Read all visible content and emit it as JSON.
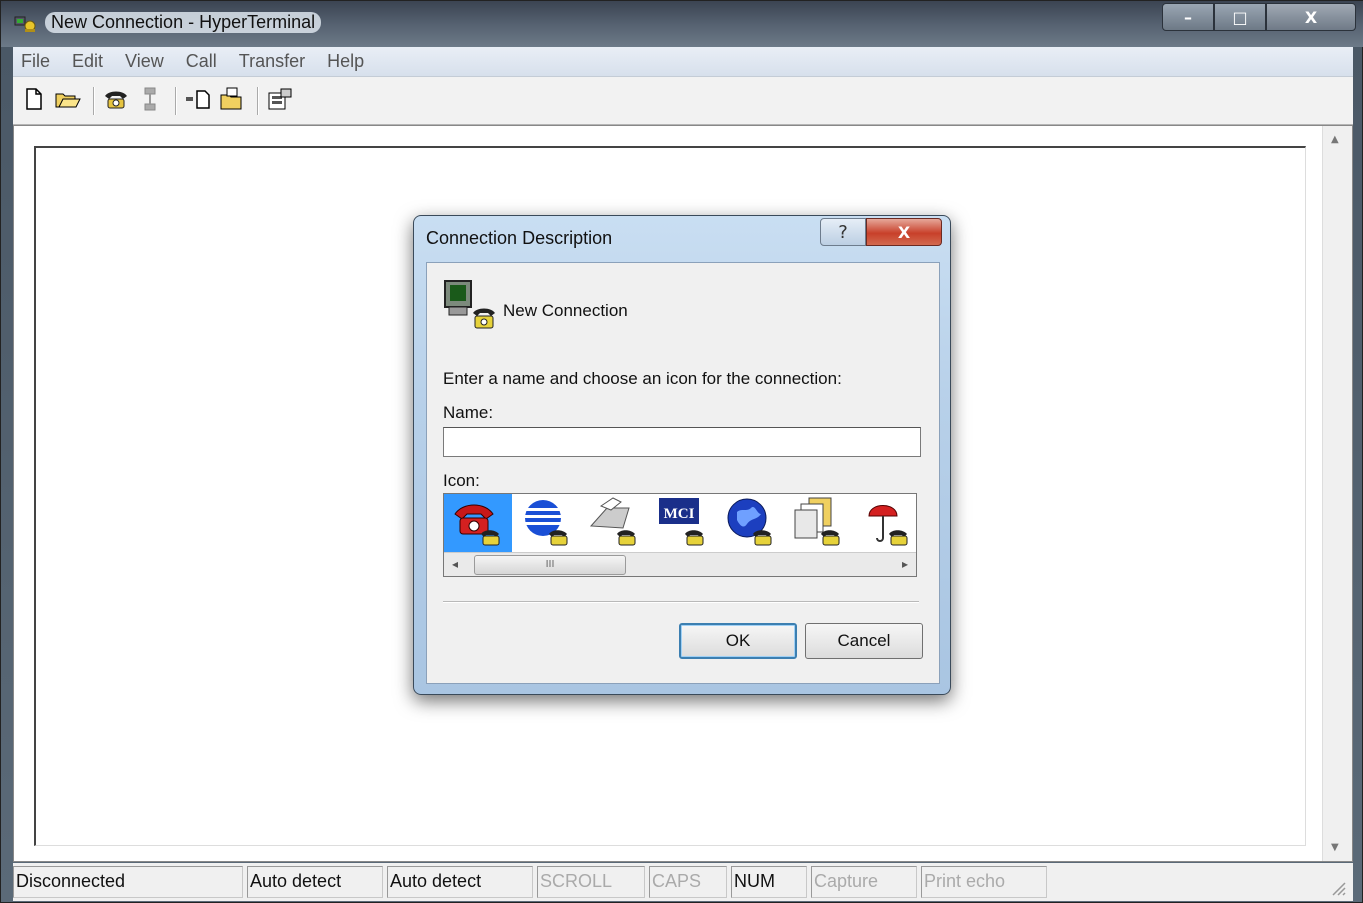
{
  "window": {
    "title": "New Connection - HyperTerminal",
    "controls": {
      "minimize": "–",
      "maximize": "□",
      "close": "X"
    }
  },
  "menu": {
    "items": [
      "File",
      "Edit",
      "View",
      "Call",
      "Transfer",
      "Help"
    ]
  },
  "toolbar": {
    "icons": [
      "new-document-icon",
      "open-folder-icon",
      "dial-phone-icon",
      "disconnect-icon",
      "send-file-icon",
      "receive-file-icon",
      "properties-icon"
    ]
  },
  "status": {
    "connection": "Disconnected",
    "detect1": "Auto detect",
    "detect2": "Auto detect",
    "scroll": "SCROLL",
    "caps": "CAPS",
    "num": "NUM",
    "capture": "Capture",
    "print_echo": "Print echo"
  },
  "dialog": {
    "title": "Connection Description",
    "help_label": "?",
    "close_label": "X",
    "connection_name": "New Connection",
    "instruction": "Enter a name and choose an icon for the connection:",
    "name_label": "Name:",
    "name_value": "",
    "icon_label": "Icon:",
    "icons": [
      "red-telephone-icon",
      "globe-stripes-icon",
      "fax-machine-icon",
      "mci-logo-icon",
      "blue-globe-icon",
      "documents-icon",
      "umbrella-icon"
    ],
    "selected_icon_index": 0,
    "scroll_thumb": "III",
    "ok_label": "OK",
    "cancel_label": "Cancel"
  },
  "colors": {
    "selection": "#3399ff",
    "dialog_gradient_top": "#c9def2",
    "close_red": "#c8402a"
  }
}
